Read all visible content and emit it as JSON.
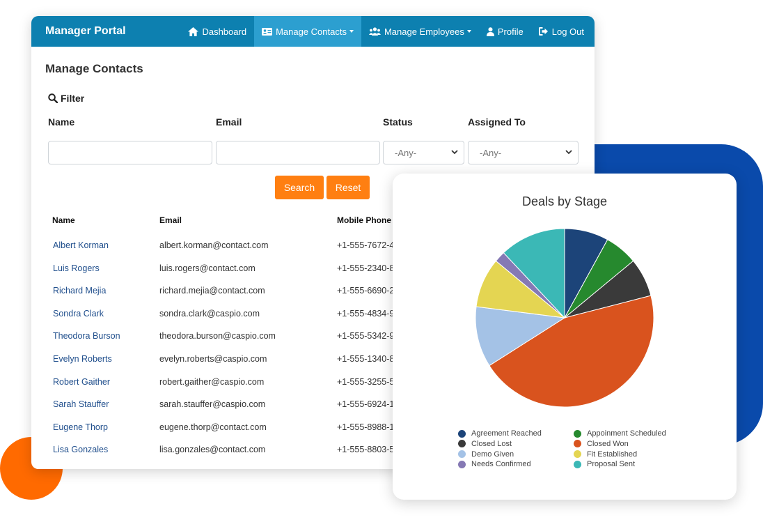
{
  "brand": "Manager Portal",
  "nav": {
    "dashboard": "Dashboard",
    "manage_contacts": "Manage Contacts",
    "manage_employees": "Manage Employees",
    "profile": "Profile",
    "log_out": "Log Out"
  },
  "page_title": "Manage Contacts",
  "filter": {
    "title": "Filter",
    "labels": {
      "name": "Name",
      "email": "Email",
      "status": "Status",
      "assigned_to": "Assigned To"
    },
    "status_value": "-Any-",
    "assigned_value": "-Any-",
    "search_label": "Search",
    "reset_label": "Reset"
  },
  "table": {
    "headers": {
      "name": "Name",
      "email": "Email",
      "phone": "Mobile Phone"
    },
    "rows": [
      {
        "name": "Albert Korman",
        "email": "albert.korman@contact.com",
        "phone": "+1-555-7672-4"
      },
      {
        "name": "Luis Rogers",
        "email": "luis.rogers@contact.com",
        "phone": "+1-555-2340-8"
      },
      {
        "name": "Richard Mejia",
        "email": "richard.mejia@contact.com",
        "phone": "+1-555-6690-2"
      },
      {
        "name": "Sondra Clark",
        "email": "sondra.clark@caspio.com",
        "phone": "+1-555-4834-9"
      },
      {
        "name": "Theodora Burson",
        "email": "theodora.burson@caspio.com",
        "phone": "+1-555-5342-9"
      },
      {
        "name": "Evelyn Roberts",
        "email": "evelyn.roberts@caspio.com",
        "phone": "+1-555-1340-8"
      },
      {
        "name": "Robert Gaither",
        "email": "robert.gaither@caspio.com",
        "phone": "+1-555-3255-5"
      },
      {
        "name": "Sarah Stauffer",
        "email": "sarah.stauffer@caspio.com",
        "phone": "+1-555-6924-1"
      },
      {
        "name": "Eugene Thorp",
        "email": "eugene.thorp@contact.com",
        "phone": "+1-555-8988-1"
      },
      {
        "name": "Lisa Gonzales",
        "email": "lisa.gonzales@contact.com",
        "phone": "+1-555-8803-5"
      }
    ]
  },
  "colors": {
    "navbar": "#0d80b0",
    "nav_active": "#2c9fd0",
    "button": "#ff7f11",
    "link": "#1f4e8c"
  },
  "chart_data": {
    "type": "pie",
    "title": "Deals by Stage",
    "legend_position": "bottom",
    "series": [
      {
        "name": "Agreement Reached",
        "value": 8,
        "color": "#1c4479"
      },
      {
        "name": "Appoinment Scheduled",
        "value": 6,
        "color": "#26892e"
      },
      {
        "name": "Closed Lost",
        "value": 7,
        "color": "#3a3a3a"
      },
      {
        "name": "Closed Won",
        "value": 45,
        "color": "#d9531e"
      },
      {
        "name": "Demo Given",
        "value": 11,
        "color": "#a4c2e6"
      },
      {
        "name": "Fit Established",
        "value": 9,
        "color": "#e4d552"
      },
      {
        "name": "Needs Confirmed",
        "value": 2,
        "color": "#8579b4"
      },
      {
        "name": "Proposal Sent",
        "value": 12,
        "color": "#3bb8b6"
      }
    ]
  }
}
